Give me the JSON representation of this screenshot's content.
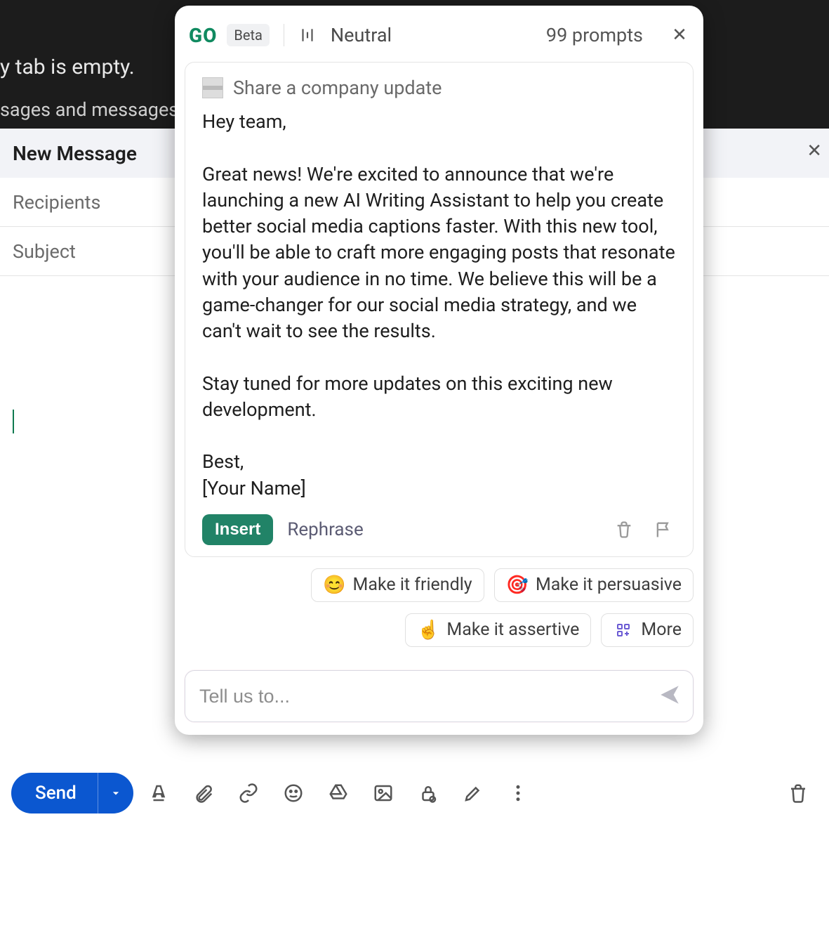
{
  "background": {
    "line1": "y tab is empty.",
    "line2": "sages and messages t"
  },
  "compose": {
    "title": "New Message",
    "recipients_placeholder": "Recipients",
    "subject_placeholder": "Subject",
    "send_label": "Send"
  },
  "assistant": {
    "logo": "GO",
    "badge": "Beta",
    "tone": "Neutral",
    "prompts_count": "99 prompts",
    "card": {
      "title": "Share a company update",
      "body": "Hey team,\n\nGreat news! We're excited to announce that we're launching a new AI Writing Assistant to help you create better social media captions faster. With this new tool, you'll be able to craft more engaging posts that resonate with your audience in no time. We believe this will be a game-changer for our social media strategy, and we can't wait to see the results.\n\nStay tuned for more updates on this exciting new development.\n\nBest,\n[Your Name]",
      "insert": "Insert",
      "rephrase": "Rephrase"
    },
    "quick": {
      "friendly": "Make it friendly",
      "persuasive": "Make it persuasive",
      "assertive": "Make it assertive",
      "more": "More"
    },
    "prompt_placeholder": "Tell us to..."
  }
}
